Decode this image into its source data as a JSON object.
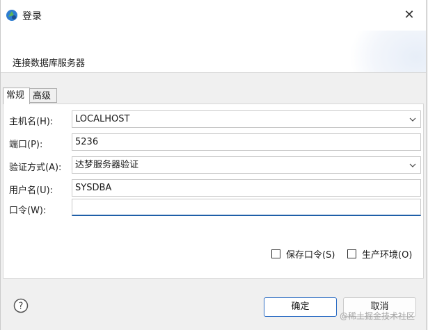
{
  "window": {
    "title": "登录"
  },
  "banner": {
    "text": "连接数据库服务器"
  },
  "tabs": [
    {
      "label": "常规",
      "active": true
    },
    {
      "label": "高级",
      "active": false
    }
  ],
  "form": {
    "host_label": "主机名(H):",
    "host_value": "LOCALHOST",
    "port_label": "端口(P):",
    "port_value": "5236",
    "auth_label": "验证方式(A):",
    "auth_value": "达梦服务器验证",
    "user_label": "用户名(U):",
    "user_value": "SYSDBA",
    "pwd_label": "口令(W):",
    "pwd_value": ""
  },
  "options": {
    "save_pwd_label": "保存口令(S)",
    "prod_env_label": "生产环境(O)"
  },
  "buttons": {
    "ok": "确定",
    "cancel": "取消"
  },
  "watermark": "@稀土掘金技术社区",
  "icons": {
    "app": "dm-app-icon",
    "close": "close-icon",
    "help": "help-icon",
    "chevron": "chevron-down-icon"
  },
  "colors": {
    "accent": "#2b6cc4",
    "focus_underline": "#1f5fa8"
  }
}
